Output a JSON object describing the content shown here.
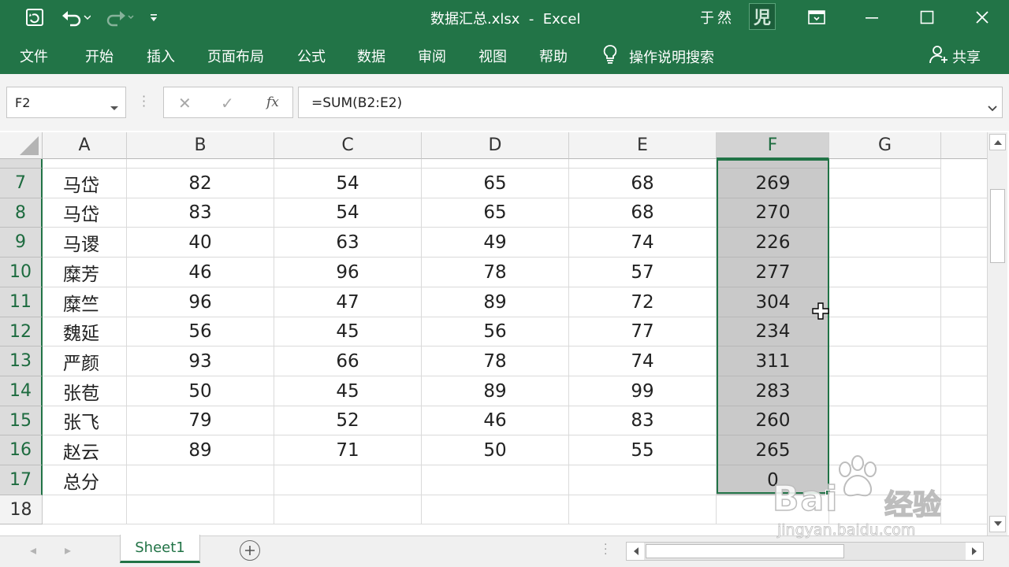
{
  "window": {
    "title": "数据汇总.xlsx  -  Excel",
    "user_name": "于然",
    "avatar_glyph": "児"
  },
  "ribbon": {
    "tabs": [
      "文件",
      "开始",
      "插入",
      "页面布局",
      "公式",
      "数据",
      "审阅",
      "视图",
      "帮助"
    ],
    "tell_me": "操作说明搜索",
    "share": "共享"
  },
  "formula_bar": {
    "name_box": "F2",
    "formula": "=SUM(B2:E2)",
    "fx_label": "fx"
  },
  "grid": {
    "columns": [
      "A",
      "B",
      "C",
      "D",
      "E",
      "F",
      "G"
    ],
    "selected_column": "F",
    "rows": [
      {
        "row": "7",
        "cells": [
          "马岱",
          "82",
          "54",
          "65",
          "68",
          "269"
        ]
      },
      {
        "row": "8",
        "cells": [
          "马岱",
          "83",
          "54",
          "65",
          "68",
          "270"
        ]
      },
      {
        "row": "9",
        "cells": [
          "马谡",
          "40",
          "63",
          "49",
          "74",
          "226"
        ]
      },
      {
        "row": "10",
        "cells": [
          "糜芳",
          "46",
          "96",
          "78",
          "57",
          "277"
        ]
      },
      {
        "row": "11",
        "cells": [
          "糜竺",
          "96",
          "47",
          "89",
          "72",
          "304"
        ]
      },
      {
        "row": "12",
        "cells": [
          "魏延",
          "56",
          "45",
          "56",
          "77",
          "234"
        ]
      },
      {
        "row": "13",
        "cells": [
          "严颜",
          "93",
          "66",
          "78",
          "74",
          "311"
        ]
      },
      {
        "row": "14",
        "cells": [
          "张苞",
          "50",
          "45",
          "89",
          "99",
          "283"
        ]
      },
      {
        "row": "15",
        "cells": [
          "张飞",
          "79",
          "52",
          "46",
          "83",
          "260"
        ]
      },
      {
        "row": "16",
        "cells": [
          "赵云",
          "89",
          "71",
          "50",
          "55",
          "265"
        ]
      },
      {
        "row": "17",
        "cells": [
          "总分",
          "",
          "",
          "",
          "",
          "0"
        ]
      },
      {
        "row": "18",
        "cells": [
          "",
          "",
          "",
          "",
          "",
          ""
        ]
      }
    ]
  },
  "sheets": {
    "tabs": [
      "Sheet1"
    ],
    "active": "Sheet1"
  },
  "watermark": {
    "brand": "Bai",
    "brand_cn": "经验",
    "url": "jingyan.baidu.com"
  },
  "colors": {
    "excel_green": "#227447",
    "selection_fill": "#c9c9c9",
    "selection_border": "#217346"
  }
}
